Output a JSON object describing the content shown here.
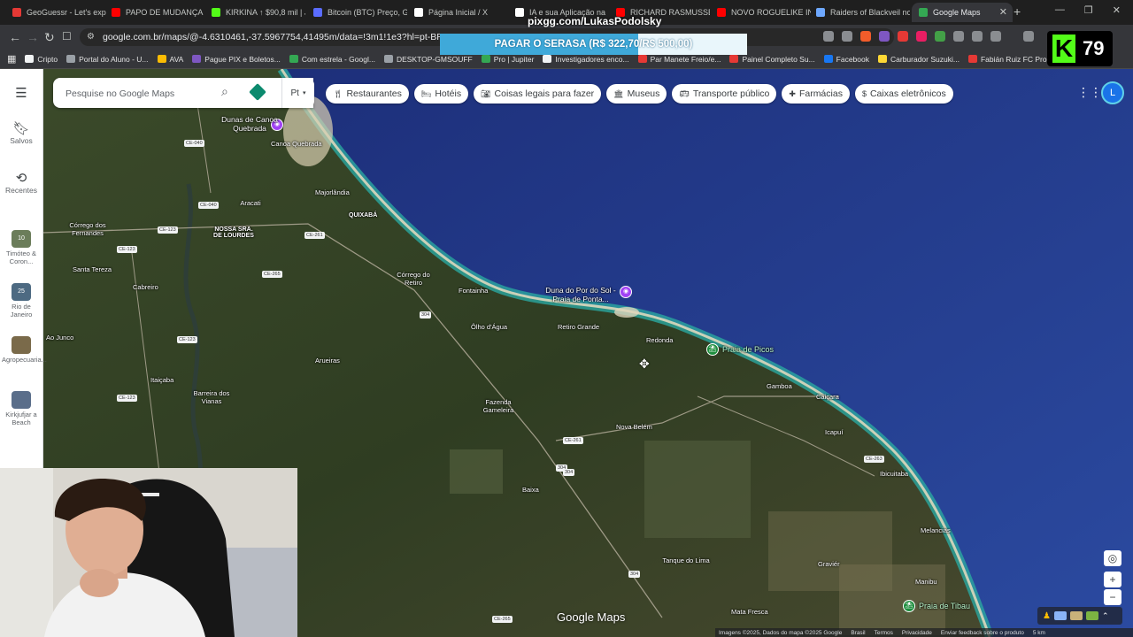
{
  "browser": {
    "tabs": [
      {
        "title": "GeoGuessr - Let's expl",
        "color": "#e53935"
      },
      {
        "title": "PAPO DE MUDANÇA D",
        "color": "#ff0000"
      },
      {
        "title": "KIRKINA ↑ $90,8 mil | J",
        "color": "#53fc18"
      },
      {
        "title": "Bitcoin (BTC) Preço, Gr",
        "color": "#5a6cff"
      },
      {
        "title": "Página Inicial / X",
        "color": "#ffffff"
      },
      {
        "title": "IA e sua Aplicação na",
        "color": "#ffffff"
      },
      {
        "title": "RICHARD RASMUSSEN",
        "color": "#ff0000"
      },
      {
        "title": "NOVO ROGUELIKE INC",
        "color": "#ff0000"
      },
      {
        "title": "Raiders of Blackveil no",
        "color": "#6ea8fe"
      },
      {
        "title": "Google Maps",
        "color": "#34a853",
        "active": true
      }
    ],
    "url": "google.com.br/maps/@-4.6310461,-37.5967754,41495m/data=!3m1!1e3?hl=pt-BR&entry=tt",
    "bookmarks": [
      {
        "label": "Cripto",
        "color": "#f1f3f4"
      },
      {
        "label": "Portal do Aluno - U...",
        "color": "#9aa0a6"
      },
      {
        "label": "AVA",
        "color": "#fbbc04"
      },
      {
        "label": "Pague PIX e Boletos...",
        "color": "#7e57c2"
      },
      {
        "label": "Com estrela - Googl...",
        "color": "#34a853"
      },
      {
        "label": "DESKTOP-GMSOUFF",
        "color": "#9aa0a6"
      },
      {
        "label": "Pro | Jupiter",
        "color": "#34a853"
      },
      {
        "label": "Investigadores enco...",
        "color": "#f1f3f4"
      },
      {
        "label": "Par Manete Freio/e...",
        "color": "#e53935"
      },
      {
        "label": "Painel Completo Su...",
        "color": "#e53935"
      },
      {
        "label": "Facebook",
        "color": "#1877f2"
      },
      {
        "label": "Carburador Suzuki...",
        "color": "#fdd835"
      },
      {
        "label": "Fabián Ruiz FC Pro L...",
        "color": "#e53935"
      }
    ]
  },
  "overlay": {
    "donation_url": "pixgg.com/LukasPodolsky",
    "donation_goal_text": "PAGAR O SERASA (R$ 322,70/R$ 500,00)",
    "donation_progress": 0.6454,
    "viewer_count": "79"
  },
  "maps": {
    "search_placeholder": "Pesquise no Google Maps",
    "language_selector": "Pt",
    "rail": {
      "saved": "Salvos",
      "recents": "Recentes",
      "history": [
        {
          "label": "Timóteo & Coron...",
          "badge": "10"
        },
        {
          "label": "Rio de Janeiro",
          "badge": "25"
        },
        {
          "label": "Agropecuaria...",
          "badge": ""
        },
        {
          "label": "Kirkjufjar a Beach",
          "badge": ""
        }
      ]
    },
    "chips": [
      {
        "label": "Restaurantes",
        "icon": "fork-knife-icon"
      },
      {
        "label": "Hotéis",
        "icon": "bed-icon"
      },
      {
        "label": "Coisas legais para fazer",
        "icon": "camera-icon"
      },
      {
        "label": "Museus",
        "icon": "museum-icon"
      },
      {
        "label": "Transporte público",
        "icon": "bus-icon"
      },
      {
        "label": "Farmácias",
        "icon": "pharmacy-icon"
      },
      {
        "label": "Caixas eletrônicos",
        "icon": "atm-icon"
      }
    ],
    "avatar_initial": "L",
    "wordmark": "Google Maps",
    "places": [
      {
        "name": "Dunas de Canoa Quebrada",
        "kind": "poi"
      },
      {
        "name": "Canoa Quebrada"
      },
      {
        "name": "Majorlândia"
      },
      {
        "name": "QUIXABÁ",
        "caps": true
      },
      {
        "name": "Aracati"
      },
      {
        "name": "NOSSA SRA. DE LOURDES",
        "caps": true
      },
      {
        "name": "Córrego dos Fernandes"
      },
      {
        "name": "Santa Tereza"
      },
      {
        "name": "Cabreiro"
      },
      {
        "name": "Córrego do Retiro"
      },
      {
        "name": "Fontainha"
      },
      {
        "name": "Duna do Por do Sol - Praia de Ponta...",
        "kind": "poi"
      },
      {
        "name": "Ôlho d'Água"
      },
      {
        "name": "Retiro Grande"
      },
      {
        "name": "Redonda"
      },
      {
        "name": "Praia de Picos",
        "kind": "green"
      },
      {
        "name": "Arueiras"
      },
      {
        "name": "Itaiçaba"
      },
      {
        "name": "Barreira dos Vianas"
      },
      {
        "name": "Fazenda Gameleira"
      },
      {
        "name": "Nova Belém"
      },
      {
        "name": "Gamboa"
      },
      {
        "name": "Caiçara"
      },
      {
        "name": "Icapuí"
      },
      {
        "name": "Ibicuitaba"
      },
      {
        "name": "Baixa"
      },
      {
        "name": "Tanque do Lima"
      },
      {
        "name": "Melancias"
      },
      {
        "name": "Graviér"
      },
      {
        "name": "Manibu"
      },
      {
        "name": "Praia de Tibau",
        "kind": "green"
      },
      {
        "name": "Mata Fresca"
      },
      {
        "name": "Ao Junco"
      }
    ],
    "road_shields": [
      "CE-040",
      "CE-040",
      "CE-123",
      "CE-123",
      "CE-265",
      "CE-261",
      "304",
      "304",
      "304",
      "CE-261",
      "CE-263",
      "304",
      "CE-265",
      "CE-123",
      "CE-123"
    ],
    "footer": [
      "Imagens ©2025, Dados do mapa ©2025 Google",
      "Brasil",
      "Termos",
      "Privacidade",
      "Enviar feedback sobre o produto",
      "5 km"
    ]
  }
}
